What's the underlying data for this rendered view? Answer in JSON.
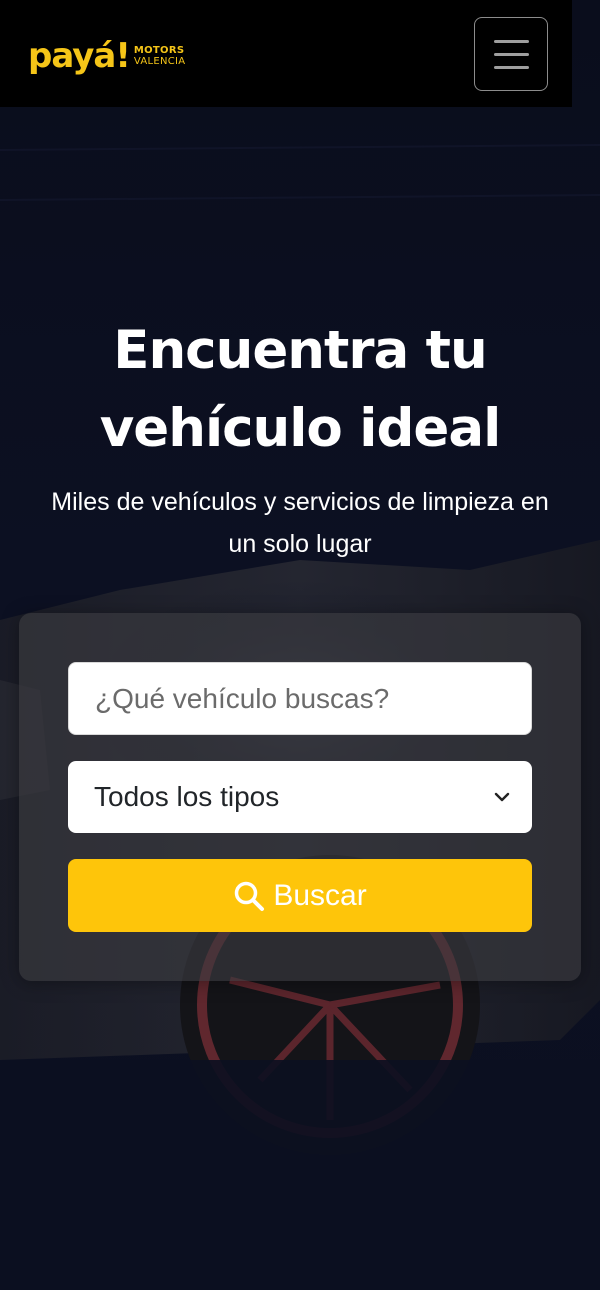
{
  "header": {
    "logo": {
      "wordmark": "payá!",
      "line1": "MOTORS",
      "line2": "VALENCIA"
    },
    "menu_icon": "hamburger-icon"
  },
  "hero": {
    "title_line1": "Encuentra tu",
    "title_line2": "vehículo ideal",
    "subtitle_line1": "Miles de vehículos y servicios de limpieza en",
    "subtitle_line2": "un solo lugar"
  },
  "search": {
    "placeholder": "¿Qué vehículo buscas?",
    "type_selected": "Todos los tipos",
    "button_label": "Buscar",
    "button_icon": "search-icon",
    "select_icon": "chevron-down-icon"
  },
  "colors": {
    "accent": "#fec50a",
    "logo": "#f5c518",
    "header_bg": "#000000",
    "hero_bg": "#0c1022"
  }
}
